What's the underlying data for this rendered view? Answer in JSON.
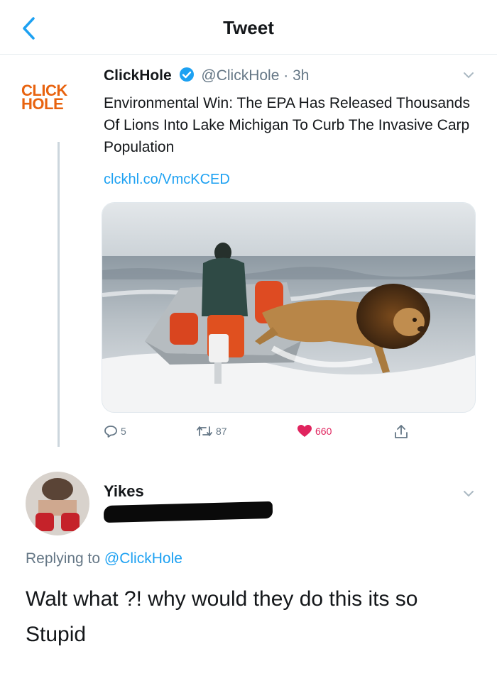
{
  "header": {
    "title": "Tweet",
    "back_icon": "chevron-left-icon"
  },
  "tweet": {
    "logo": {
      "line1": "CLICK",
      "line2": "HOLE",
      "color": "#e8630f"
    },
    "author_name": "ClickHole",
    "verified_icon": "verified-badge-icon",
    "handle": "@ClickHole",
    "separator": "·",
    "time": "3h",
    "text": "Environmental Win: The EPA Has Released Thousands Of Lions Into Lake Michigan To Curb The Invasive Carp Population",
    "link": "clckhl.co/VmcKCED",
    "actions": {
      "reply_count": "5",
      "retweet_count": "87",
      "like_count": "660",
      "reply_icon": "reply-icon",
      "retweet_icon": "retweet-icon",
      "like_icon": "heart-icon",
      "share_icon": "share-icon"
    }
  },
  "reply": {
    "author_name": "Yikes",
    "replying_prefix": "Replying to ",
    "replying_mention": "@ClickHole",
    "text": "Walt what ?! why would they do this its so Stupid"
  },
  "colors": {
    "accent": "#1da1f2",
    "like": "#e0245e",
    "muted": "#657786"
  }
}
